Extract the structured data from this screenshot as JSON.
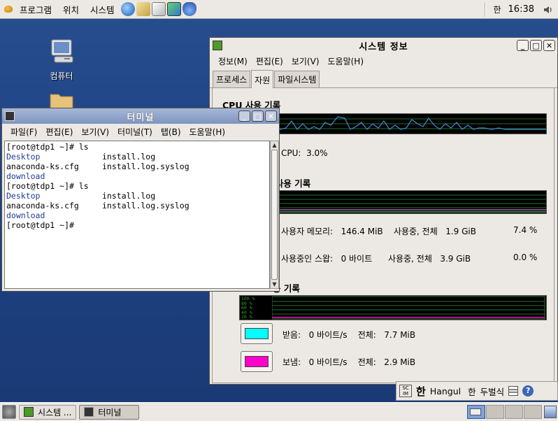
{
  "top_panel": {
    "menus": [
      "프로그램",
      "위치",
      "시스템"
    ],
    "input_indicator": "한",
    "clock": "16:38"
  },
  "desktop": {
    "icons": [
      {
        "label": "컴퓨터"
      }
    ]
  },
  "sysinfo": {
    "title": "시스템 정보",
    "menus": [
      "정보(M)",
      "편집(E)",
      "보기(V)",
      "도움말(H)"
    ],
    "tabs": [
      "프로세스",
      "자원",
      "파일시스템"
    ],
    "active_tab": "자원",
    "cpu": {
      "heading": "CPU 사용 기록",
      "label": "CPU:",
      "value": "3.0%"
    },
    "memory": {
      "heading": "암 사용 기록",
      "user_mem_label": "사용자 메모리:",
      "user_mem_value": "146.4 MiB",
      "used_total_label": "사용중, 전체",
      "mem_total": "1.9 GiB",
      "mem_percent": "7.4 %",
      "swap_label": "사용중인 스왑:",
      "swap_value": "0 바이트",
      "swap_total": "3.9 GiB",
      "swap_percent": "0.0 %"
    },
    "network": {
      "heading": "용 기록",
      "scale_labels": [
        "100 %",
        "80 %",
        "60 %",
        "40 %",
        "20 %"
      ],
      "recv_label": "받음:",
      "recv_rate": "0 바이트/s",
      "recv_total_label": "전체:",
      "recv_total": "7.7 MiB",
      "sent_label": "보냄:",
      "sent_rate": "0 바이트/s",
      "sent_total_label": "전체:",
      "sent_total": "2.9 MiB",
      "recv_color": "#00ffff",
      "sent_color": "#ff00cc"
    },
    "cpu_graph_color": "#3a8fd8",
    "mem_graph_color": "#a060c0",
    "swap_graph_color": "#40a040"
  },
  "terminal": {
    "title": "터미널",
    "menus": [
      "파일(F)",
      "편집(E)",
      "보기(V)",
      "터미널(T)",
      "탭(B)",
      "도움말(H)"
    ],
    "lines": [
      {
        "a": "[root@tdp1 ~]# ls",
        "b": ""
      },
      {
        "a": "Desktop",
        "b": "install.log"
      },
      {
        "a": "anaconda-ks.cfg",
        "b": "install.log.syslog"
      },
      {
        "a": "download",
        "b": ""
      },
      {
        "a": "[root@tdp1 ~]# ls",
        "b": ""
      },
      {
        "a": "Desktop",
        "b": "install.log"
      },
      {
        "a": "anaconda-ks.cfg",
        "b": "install.log.syslog"
      },
      {
        "a": "download",
        "b": ""
      },
      {
        "a": "[root@tdp1 ~]#",
        "b": ""
      }
    ]
  },
  "imbar": {
    "lang_glyph": "한",
    "lang_name": "Hangul",
    "mode": "한",
    "layout": "두벌식"
  },
  "taskbar": {
    "tasks": [
      {
        "label": "시스템 ..."
      },
      {
        "label": "터미널"
      }
    ]
  }
}
